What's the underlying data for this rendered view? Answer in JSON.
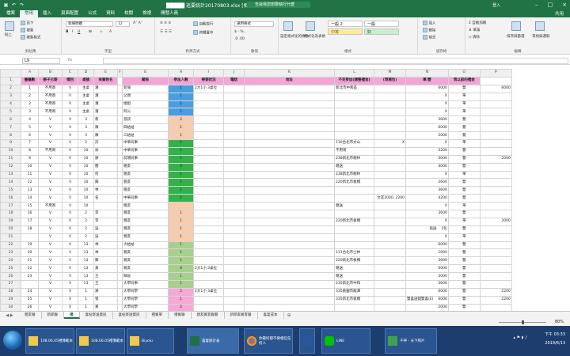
{
  "window": {
    "title": "█████ 巡要統計20170803.xlsx [相容模式] - Excel",
    "search_placeholder": "告訴我您想要執行什麼",
    "account_label": "登入",
    "share_label": "共用"
  },
  "ribbon_tabs": [
    "檔案",
    "常用",
    "插入",
    "頁面配置",
    "公式",
    "資料",
    "校閱",
    "檢視",
    "開發人員"
  ],
  "active_tab": "常用",
  "ribbon": {
    "clipboard": {
      "name": "剪貼簿",
      "paste": "貼上",
      "cut": "剪下",
      "copy": "複製",
      "format_painter": "複製格式"
    },
    "font": {
      "name": "字型",
      "font_family": "新細明體",
      "font_size": "12"
    },
    "alignment": {
      "name": "對齊方式",
      "wrap": "自動換行",
      "merge": "跨欄置中"
    },
    "number": {
      "name": "數值",
      "format": "通用格式"
    },
    "styles": {
      "name": "樣式",
      "conditional": "設定格式化的條件",
      "table": "格式化為表格",
      "normal": "一般 2",
      "normal2": "一般",
      "neutral": "中等",
      "good": "好"
    },
    "cells": {
      "name": "儲存格",
      "insert": "插入",
      "delete": "刪除",
      "format": "格式"
    },
    "editing": {
      "name": "編輯",
      "autosum": "自動加總",
      "fill": "填滿",
      "clear": "清除",
      "sort": "排序與篩選",
      "find": "尋找與選取"
    }
  },
  "formula_bar": {
    "name_box": "L9",
    "fx": "fx",
    "value": ""
  },
  "columns": [
    "A",
    "B",
    "C",
    "D",
    "E",
    "F",
    "G",
    "H",
    "I",
    "J",
    "K",
    "L",
    "M",
    "N",
    "O",
    "P"
  ],
  "header_row": [
    "書籍數",
    "帳子已寄",
    "領回",
    "桌號",
    "來賓姓名",
    "",
    "關係",
    "參加人數",
    "帶寄狀況",
    "電話",
    "地址",
    "不克參加(請整禮金)",
    "(現場包)",
    "單/雙",
    "我以前的禮金",
    ""
  ],
  "rows": [
    {
      "n": "2",
      "a": "1",
      "b": "不用寄",
      "c": "V",
      "d": "主桌",
      "e": "潘",
      "g": "新埔",
      "h": "1",
      "i": "2大1小 3桌位",
      "k": "新北市中和區",
      "m": "6000",
      "o": "雙",
      "p": "6000"
    },
    {
      "n": "3",
      "a": "2",
      "b": "不用寄",
      "c": "V",
      "d": "主桌",
      "e": "潘",
      "g": "父親",
      "h": "1",
      "m": "X",
      "o": "單"
    },
    {
      "n": "4",
      "a": "2",
      "b": "不用寄",
      "c": "V",
      "d": "主桌",
      "e": "潘",
      "g": "姐姐",
      "h": "1",
      "m": "X",
      "o": "單"
    },
    {
      "n": "5",
      "a": "3",
      "b": "不用寄",
      "c": "V",
      "d": "主桌",
      "e": "潘",
      "g": "阿公",
      "h": "1",
      "m": "X",
      "o": "單"
    },
    {
      "n": "6",
      "a": "4",
      "b": "V",
      "c": "V",
      "d": "3",
      "e": "蔡",
      "g": "叔叔",
      "h": "2",
      "m": "3600",
      "o": "雙"
    },
    {
      "n": "7",
      "a": "5",
      "b": "V",
      "c": "V",
      "d": "3",
      "e": "陳",
      "g": "四姑姑",
      "h": "1",
      "m": "6000",
      "o": "雙"
    },
    {
      "n": "8",
      "a": "6",
      "b": "V",
      "c": "V",
      "d": "3",
      "e": "陳",
      "g": "三姑姑",
      "h": "1",
      "m": "2000",
      "o": "雙"
    },
    {
      "n": "9",
      "a": "7",
      "b": "V",
      "c": "V",
      "d": "2",
      "e": "許",
      "g": "中華同事",
      "h": "1",
      "k": "110台北市文山",
      "l": "X",
      "m": "X",
      "o": "單"
    },
    {
      "n": "10",
      "a": "8",
      "b": "不用寄",
      "c": "V",
      "d": "10",
      "e": "徐",
      "g": "中華同事",
      "h": "1",
      "k": "不用寄",
      "m": "3200",
      "o": "雙"
    },
    {
      "n": "11",
      "a": "9",
      "b": "V",
      "c": "V",
      "d": "10",
      "e": "廖",
      "g": "前期同事",
      "h": "1",
      "k": "238新北市樹林",
      "m": "3000",
      "o": "雙",
      "p": "2000"
    },
    {
      "n": "12",
      "a": "10",
      "b": "V",
      "c": "V",
      "d": "10",
      "e": "簡",
      "g": "親友",
      "h": "2",
      "k": "親送",
      "m": "4000",
      "o": "雙"
    },
    {
      "n": "13",
      "a": "11",
      "b": "V",
      "c": "V",
      "d": "10",
      "e": "何",
      "g": "親友",
      "h": "1",
      "k": "238新北市樹林",
      "m": "X",
      "o": "單"
    },
    {
      "n": "14",
      "a": "12",
      "b": "V",
      "c": "V",
      "d": "10",
      "e": "蘇",
      "g": "親友",
      "h": "1",
      "k": "220新北市板橋",
      "m": "2600",
      "o": "雙"
    },
    {
      "n": "15",
      "a": "13",
      "b": "V",
      "c": "V",
      "d": "10",
      "e": "林",
      "g": "親友",
      "h": "1",
      "m": "3600",
      "o": "雙"
    },
    {
      "n": "16",
      "a": "14",
      "b": "V",
      "c": "V",
      "d": "10",
      "e": "名",
      "g": "中華同事",
      "h": "1",
      "l": "文友2000,   2200",
      "m": "4200",
      "o": "雙"
    },
    {
      "n": "17",
      "a": "15",
      "b": "不用寄",
      "c": "V",
      "d": "10",
      "e": "",
      "g": "親友",
      "h": "",
      "k": "親送",
      "m": "X",
      "o": "單"
    },
    {
      "n": "18",
      "a": "16",
      "b": "V",
      "c": "V",
      "d": "2",
      "e": "李",
      "g": "親友",
      "h": "1",
      "m": "3600",
      "o": "雙"
    },
    {
      "n": "19",
      "a": "17",
      "b": "V",
      "c": "V",
      "d": "2",
      "e": "李",
      "g": "親友",
      "h": "1",
      "k": "220新北市板橋",
      "m": "X",
      "o": "單",
      "p": "2000"
    },
    {
      "n": "20",
      "a": "18",
      "b": "V",
      "c": "V",
      "d": "2",
      "e": "吳",
      "g": "親友",
      "h": "1",
      "l": "",
      "m": "2包",
      "mm": "再送",
      "o": "雙"
    },
    {
      "n": "21",
      "a": "",
      "b": "V",
      "c": "V",
      "d": "2",
      "e": "吳",
      "g": "親友",
      "h": "1",
      "m": "X",
      "o": "單"
    },
    {
      "n": "22",
      "a": "19",
      "b": "V",
      "c": "V",
      "d": "13",
      "e": "林",
      "g": "大姑姑",
      "h": "1",
      "m": "6000",
      "o": "雙"
    },
    {
      "n": "23",
      "a": "20",
      "b": "V",
      "c": "V",
      "d": "13",
      "e": "林",
      "g": "親友",
      "h": "1",
      "k": "111台北市士林",
      "m": "1600",
      "o": "雙"
    },
    {
      "n": "24",
      "a": "21",
      "b": "V",
      "c": "V",
      "d": "13",
      "e": "鄭",
      "g": "親友",
      "h": "1",
      "k": "220新北市板橋",
      "m": "3600",
      "o": "雙"
    },
    {
      "n": "25",
      "a": "22",
      "b": "V",
      "c": "V",
      "d": "13",
      "e": "黃",
      "g": "親友",
      "h": "4",
      "i": "2大1小 3桌位",
      "k": "親送",
      "m": "6000",
      "o": "雙"
    },
    {
      "n": "26",
      "a": "23",
      "b": "V",
      "c": "V",
      "d": "13",
      "e": "王",
      "g": "鄰居",
      "h": "1",
      "k": "親送",
      "m": "3000",
      "o": "雙"
    },
    {
      "n": "27",
      "a": "",
      "b": "V",
      "c": "V",
      "d": "13",
      "e": "王",
      "g": "大學同事",
      "h": "1",
      "k": "235新北市中和",
      "m": "3600",
      "o": "雙"
    },
    {
      "n": "28",
      "a": "24",
      "b": "V",
      "c": "V",
      "d": "1",
      "e": "謝",
      "g": "大學同學",
      "h": "2",
      "i": "2大1小 3桌位",
      "k": "335桃園市龍潭",
      "m": "6000",
      "o": "雙",
      "p": "2200"
    },
    {
      "n": "29",
      "a": "25",
      "b": "V",
      "c": "V",
      "d": "1",
      "e": "張",
      "g": "大學同學",
      "h": "1",
      "k": "335新北市板橋",
      "mm": "雙喜送錢雙喜(E)",
      "m": "6000",
      "o": "雙",
      "p": "2200"
    },
    {
      "n": "30",
      "a": "26",
      "b": "V",
      "c": "V",
      "d": "1",
      "e": "黃",
      "g": "大學同學",
      "h": "2",
      "m": "2000",
      "o": "雙"
    },
    {
      "n": "31",
      "a": "27",
      "b": "V",
      "c": "V",
      "d": "1",
      "e": "廖",
      "g": "大學同學",
      "h": "4",
      "k": "300新竹市東區",
      "m": "6000",
      "o": "雙",
      "p": "1800"
    },
    {
      "n": "32",
      "a": "28",
      "b": "V",
      "c": "V",
      "d": "1",
      "e": "陳",
      "g": "大學同學",
      "h": "1",
      "m": "3600",
      "o": "雙"
    }
  ],
  "colors": {
    "blue_rows": [
      "2",
      "3",
      "4",
      "5"
    ],
    "peach_rows": [
      "6",
      "7",
      "8",
      "17",
      "18",
      "19",
      "20",
      "21"
    ],
    "green_rows": [
      "9",
      "10",
      "11",
      "12",
      "13",
      "14",
      "15",
      "16"
    ],
    "lgreen_rows": [
      "22",
      "23",
      "24",
      "25",
      "26",
      "27"
    ],
    "pink_rows": [
      "28",
      "29",
      "30",
      "31",
      "32"
    ]
  },
  "sheet_tabs": [
    "親友聯",
    "新郎聯",
    "禮",
    "喜帖寄送資訊",
    "喜帖寄送資訊",
    "禮賓單",
    "禮賓聯",
    "親友賓客聯繫",
    "新郎家賓客聯",
    "喜宴成本"
  ],
  "active_sheet": "禮",
  "status": {
    "zoom": "80%"
  },
  "taskbar": {
    "items": [
      "108.06.05禮簿範本",
      "108.06.05禮簿範本",
      "Biyolu",
      "喜宴統計表",
      "你最好都不要相信任何人",
      "",
      "LINE",
      "千寧 - 天下照片"
    ],
    "time": "下午 03:33",
    "date": "2019/6/13"
  }
}
